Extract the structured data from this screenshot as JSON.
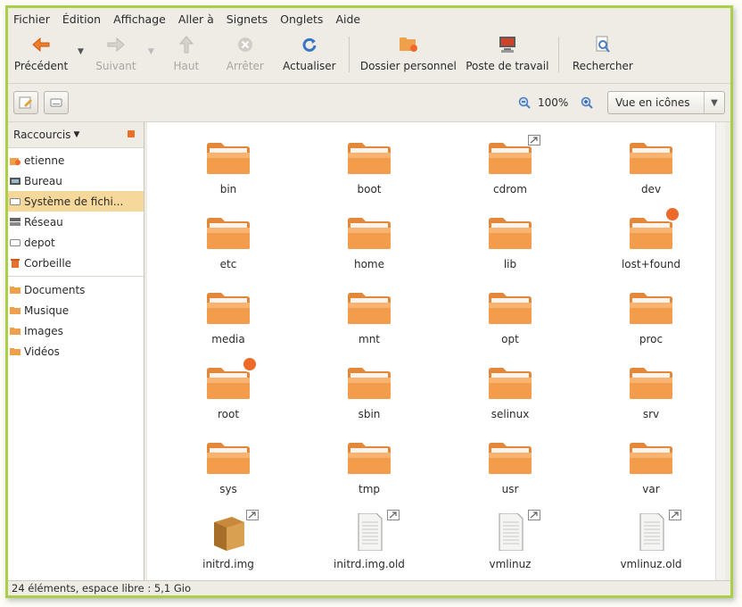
{
  "menu": [
    "Fichier",
    "Édition",
    "Affichage",
    "Aller à",
    "Signets",
    "Onglets",
    "Aide"
  ],
  "toolbar": {
    "back": "Précédent",
    "forward": "Suivant",
    "up": "Haut",
    "stop": "Arrêter",
    "reload": "Actualiser",
    "home": "Dossier personnel",
    "computer": "Poste de travail",
    "search": "Rechercher"
  },
  "location": {
    "zoom": "100%",
    "view_mode": "Vue en icônes"
  },
  "sidebar": {
    "title": "Raccourcis",
    "items": [
      {
        "label": "etienne",
        "icon": "home-icon",
        "selected": false
      },
      {
        "label": "Bureau",
        "icon": "desktop-icon",
        "selected": false
      },
      {
        "label": "Système de fichi...",
        "icon": "drive-icon",
        "selected": true
      },
      {
        "label": "Réseau",
        "icon": "network-icon",
        "selected": false
      },
      {
        "label": "depot",
        "icon": "drive-icon",
        "selected": false
      },
      {
        "label": "Corbeille",
        "icon": "trash-icon",
        "selected": false
      }
    ],
    "bookmarks": [
      {
        "label": "Documents",
        "icon": "folder-icon"
      },
      {
        "label": "Musique",
        "icon": "folder-icon"
      },
      {
        "label": "Images",
        "icon": "folder-icon"
      },
      {
        "label": "Vidéos",
        "icon": "folder-icon"
      }
    ]
  },
  "files": [
    {
      "name": "bin",
      "type": "folder",
      "emblem": ""
    },
    {
      "name": "boot",
      "type": "folder",
      "emblem": ""
    },
    {
      "name": "cdrom",
      "type": "folder",
      "emblem": "link"
    },
    {
      "name": "dev",
      "type": "folder",
      "emblem": ""
    },
    {
      "name": "etc",
      "type": "folder",
      "emblem": ""
    },
    {
      "name": "home",
      "type": "folder",
      "emblem": ""
    },
    {
      "name": "lib",
      "type": "folder",
      "emblem": ""
    },
    {
      "name": "lost+found",
      "type": "folder",
      "emblem": "locked"
    },
    {
      "name": "media",
      "type": "folder",
      "emblem": ""
    },
    {
      "name": "mnt",
      "type": "folder",
      "emblem": ""
    },
    {
      "name": "opt",
      "type": "folder",
      "emblem": ""
    },
    {
      "name": "proc",
      "type": "folder",
      "emblem": ""
    },
    {
      "name": "root",
      "type": "folder",
      "emblem": "locked"
    },
    {
      "name": "sbin",
      "type": "folder",
      "emblem": ""
    },
    {
      "name": "selinux",
      "type": "folder",
      "emblem": ""
    },
    {
      "name": "srv",
      "type": "folder",
      "emblem": ""
    },
    {
      "name": "sys",
      "type": "folder",
      "emblem": ""
    },
    {
      "name": "tmp",
      "type": "folder",
      "emblem": ""
    },
    {
      "name": "usr",
      "type": "folder",
      "emblem": ""
    },
    {
      "name": "var",
      "type": "folder",
      "emblem": ""
    },
    {
      "name": "initrd.img",
      "type": "archive",
      "emblem": "link"
    },
    {
      "name": "initrd.img.old",
      "type": "document",
      "emblem": "link"
    },
    {
      "name": "vmlinuz",
      "type": "document",
      "emblem": "link"
    },
    {
      "name": "vmlinuz.old",
      "type": "document",
      "emblem": "link"
    }
  ],
  "status": "24 éléments, espace libre : 5,1 Gio",
  "colors": {
    "accent_border": "#a9cf4d",
    "folder": "#f0a04b",
    "selection": "#f5d89a"
  }
}
